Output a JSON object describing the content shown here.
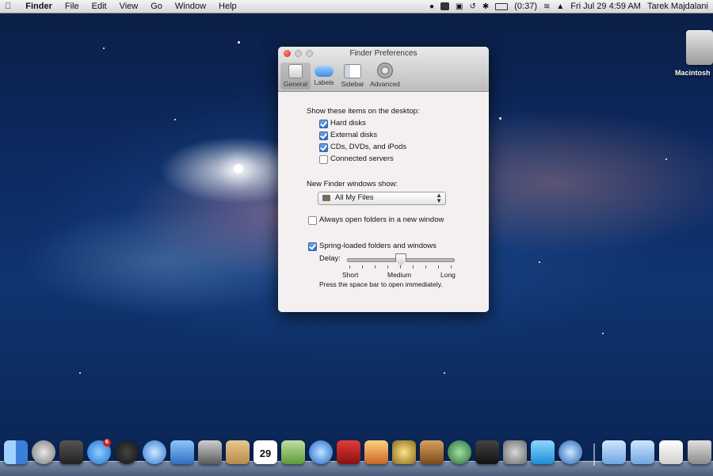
{
  "menubar": {
    "app_name": "Finder",
    "menus": [
      "File",
      "Edit",
      "View",
      "Go",
      "Window",
      "Help"
    ],
    "status": {
      "battery": "(0:37)",
      "datetime": "Fri Jul 29  4:59 AM",
      "user": "Tarek Majdalani"
    }
  },
  "desktop": {
    "disk_label": "Macintosh"
  },
  "window": {
    "title": "Finder Preferences",
    "toolbar": [
      "General",
      "Labels",
      "Sidebar",
      "Advanced"
    ],
    "selected_tab": "General",
    "desktop_heading": "Show these items on the desktop:",
    "desktop_items": [
      {
        "label": "Hard disks",
        "checked": true
      },
      {
        "label": "External disks",
        "checked": true
      },
      {
        "label": "CDs, DVDs, and iPods",
        "checked": true
      },
      {
        "label": "Connected servers",
        "checked": false
      }
    ],
    "new_window_heading": "New Finder windows show:",
    "new_window_value": "All My Files",
    "always_open_new_window": {
      "label": "Always open folders in a new window",
      "checked": false
    },
    "spring_loaded": {
      "label": "Spring-loaded folders and windows",
      "checked": true
    },
    "delay_label": "Delay:",
    "delay_ticks": [
      "Short",
      "Medium",
      "Long"
    ],
    "delay_level": 0.5,
    "hint": "Press the space bar to open immediately."
  },
  "dock": {
    "apps": [
      "finder-icon",
      "launchpad-icon",
      "mission-control-icon",
      "app-store-icon",
      "dashboard-icon",
      "safari-icon",
      "mail-icon",
      "facetime-icon",
      "address-book-icon",
      "ical-icon",
      "preview-icon",
      "itunes-icon",
      "photo-booth-icon",
      "iphoto-icon",
      "imovie-icon",
      "garageband-icon",
      "time-machine-icon",
      "final-cut-icon",
      "system-preferences-icon",
      "twitter-icon",
      "quicktime-icon"
    ],
    "app_store_badge": "6",
    "ical_date": "29",
    "right_items": [
      "applications-folder-icon",
      "documents-folder-icon",
      "downloads-stack-icon",
      "trash-icon"
    ]
  },
  "colors": {
    "accent_blue": "#2d6fc8",
    "close_red": "#c8231a"
  }
}
